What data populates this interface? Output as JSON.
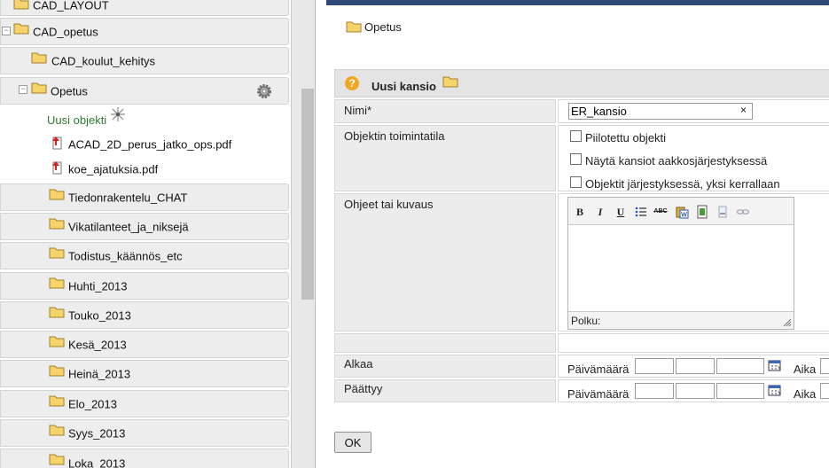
{
  "tree": {
    "items": [
      {
        "label": "CAD_LAYOUT"
      },
      {
        "label": "CAD_opetus"
      },
      {
        "label": "CAD_koulut_kehitys"
      },
      {
        "label": "Opetus"
      },
      {
        "label": "Uusi objekti"
      },
      {
        "label": "ACAD_2D_perus_jatko_ops.pdf"
      },
      {
        "label": "koe_ajatuksia.pdf"
      },
      {
        "label": "Tiedonrakentelu_CHAT"
      },
      {
        "label": "Vikatilanteet_ja_niksejä"
      },
      {
        "label": "Todistus_käännös_etc"
      },
      {
        "label": "Huhti_2013"
      },
      {
        "label": "Touko_2013"
      },
      {
        "label": "Kesä_2013"
      },
      {
        "label": "Heinä_2013"
      },
      {
        "label": "Elo_2013"
      },
      {
        "label": "Syys_2013"
      },
      {
        "label": "Loka_2013"
      }
    ],
    "toggle_minus": "−"
  },
  "panel": {
    "breadcrumb": "Opetus",
    "form_title": "Uusi kansio",
    "help_glyph": "?",
    "fields": {
      "name_label": "Nimi*",
      "name_value": "ER_kansio",
      "clear_glyph": "×",
      "mode_label": "Objektin toimintatila",
      "checkboxes": [
        "Piilotettu objekti",
        "Näytä kansiot aakkosjärjestyksessä",
        "Objektit järjestyksessä, yksi kerrallaan"
      ],
      "desc_label": "Ohjeet tai kuvaus",
      "editor_status": "Polku:",
      "start_label": "Alkaa",
      "end_label": "Päättyy",
      "date_label": "Päivämäärä",
      "time_label": "Aika"
    },
    "toolbar": {
      "bold": "B",
      "italic": "I",
      "underline": "U",
      "abc": "ABC"
    },
    "ok_label": "OK"
  },
  "colors": {
    "topbar": "#2f4a78",
    "new_object_text": "#2e7d2e",
    "folder_yellow": "#f6d36b"
  }
}
